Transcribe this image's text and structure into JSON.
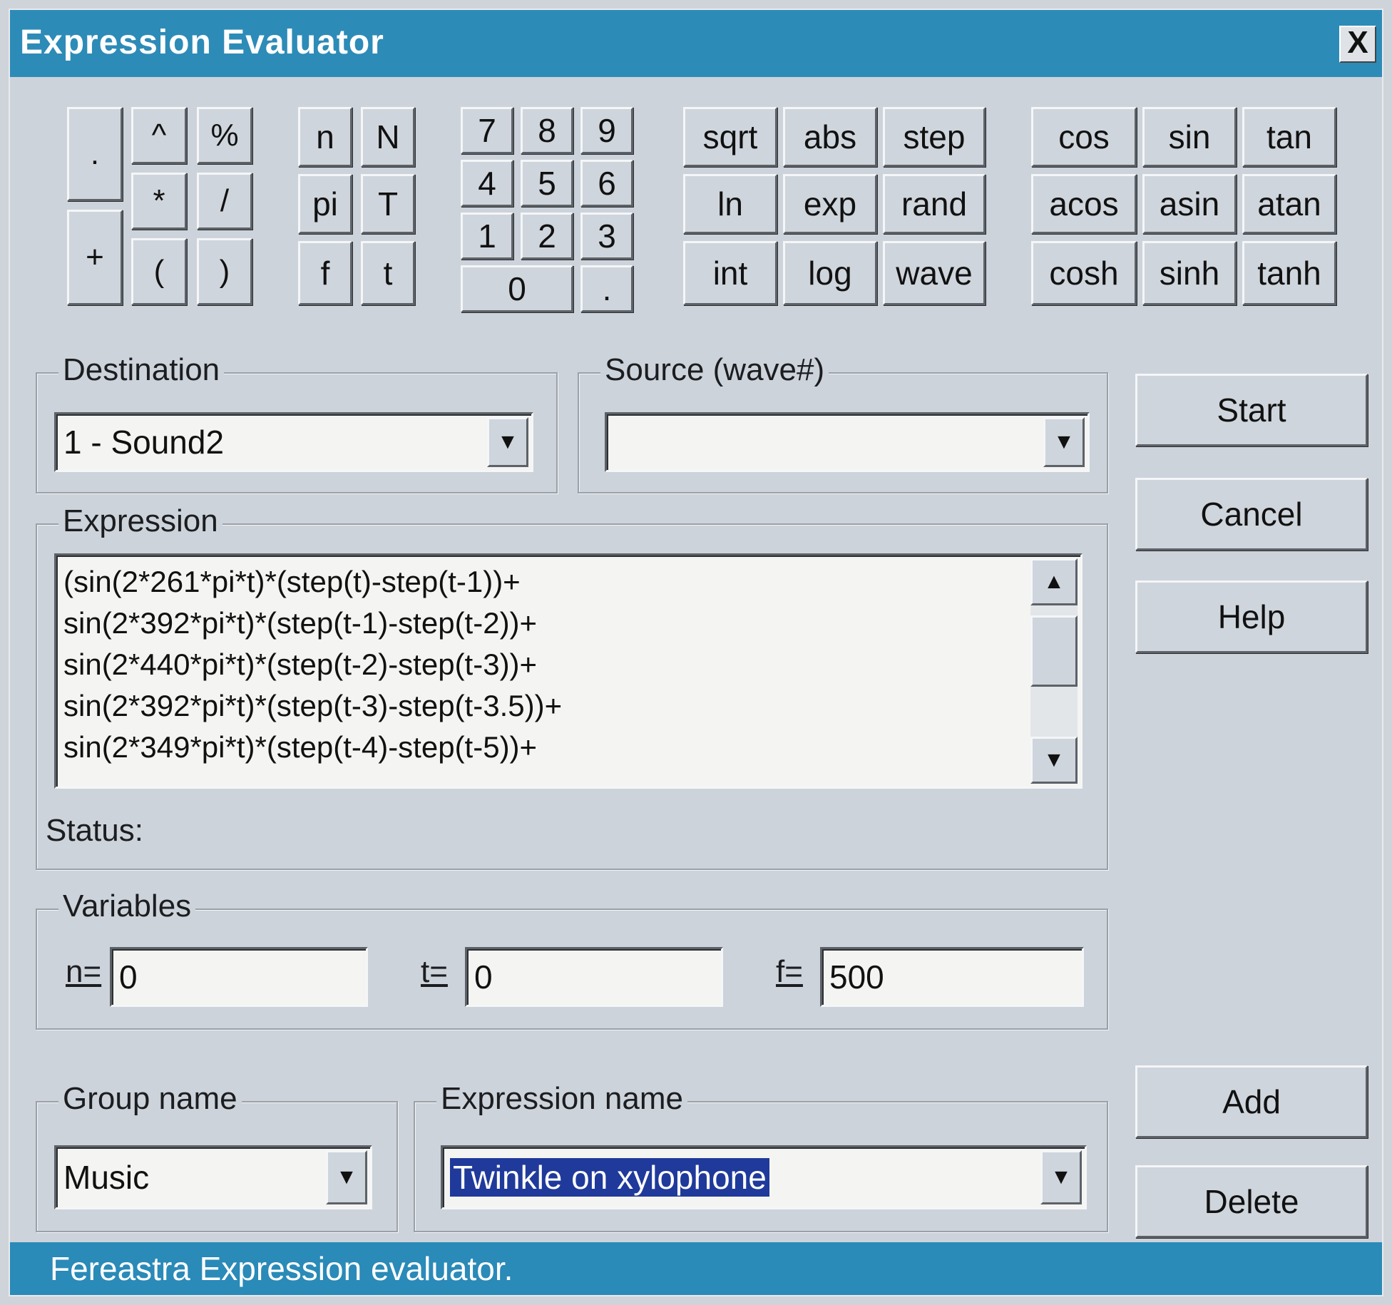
{
  "window": {
    "title": "Expression Evaluator",
    "close_label": "X"
  },
  "keypad": {
    "ops": [
      ".",
      "^",
      "%",
      "*",
      "/",
      "+",
      "(",
      ")"
    ],
    "vars": [
      "n",
      "N",
      "pi",
      "T",
      "f",
      "t"
    ],
    "digits": [
      "7",
      "8",
      "9",
      "4",
      "5",
      "6",
      "1",
      "2",
      "3",
      "0",
      "."
    ],
    "funcs1": [
      "sqrt",
      "abs",
      "step",
      "ln",
      "exp",
      "rand",
      "int",
      "log",
      "wave"
    ],
    "funcs2": [
      "cos",
      "sin",
      "tan",
      "acos",
      "asin",
      "atan",
      "cosh",
      "sinh",
      "tanh"
    ]
  },
  "destination": {
    "label": "Destination",
    "value": "1 - Sound2"
  },
  "source": {
    "label": "Source (wave#)",
    "value": ""
  },
  "expression": {
    "label": "Expression",
    "lines": [
      "(sin(2*261*pi*t)*(step(t)-step(t-1))+",
      "sin(2*392*pi*t)*(step(t-1)-step(t-2))+",
      "sin(2*440*pi*t)*(step(t-2)-step(t-3))+",
      "sin(2*392*pi*t)*(step(t-3)-step(t-3.5))+",
      "sin(2*349*pi*t)*(step(t-4)-step(t-5))+"
    ],
    "status_label": "Status:"
  },
  "variables": {
    "label": "Variables",
    "n_label": "n=",
    "n_value": "0",
    "t_label": "t=",
    "t_value": "0",
    "f_label": "f=",
    "f_value": "500"
  },
  "group_name": {
    "label": "Group name",
    "value": "Music"
  },
  "expression_name": {
    "label": "Expression name",
    "value": "Twinkle on xylophone"
  },
  "buttons": {
    "start": "Start",
    "cancel": "Cancel",
    "help": "Help",
    "add": "Add",
    "delete": "Delete"
  },
  "statusbar": {
    "text": "Fereastra Expression evaluator."
  },
  "colors": {
    "titlebar": "#2d8bb7",
    "statusbar": "#2a8ab8",
    "face": "#cdd3da",
    "selection": "#1f3a9a"
  }
}
